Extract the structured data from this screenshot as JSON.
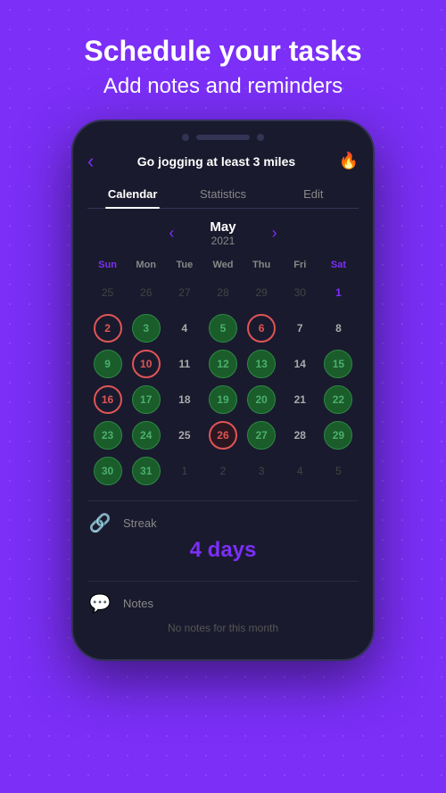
{
  "header": {
    "line1": "Schedule your tasks",
    "line2": "Add notes and reminders"
  },
  "phone": {
    "task_title": "Go jogging at least 3 miles",
    "tabs": [
      {
        "label": "Calendar",
        "active": true
      },
      {
        "label": "Statistics",
        "active": false
      },
      {
        "label": "Edit",
        "active": false
      }
    ],
    "calendar": {
      "month": "May",
      "year": "2021",
      "weekdays": [
        "Sun",
        "Mon",
        "Tue",
        "Wed",
        "Thu",
        "Fri",
        "Sat"
      ],
      "rows": [
        [
          {
            "num": "25",
            "type": "empty"
          },
          {
            "num": "26",
            "type": "empty"
          },
          {
            "num": "27",
            "type": "empty"
          },
          {
            "num": "28",
            "type": "empty"
          },
          {
            "num": "29",
            "type": "empty"
          },
          {
            "num": "30",
            "type": "empty"
          },
          {
            "num": "1",
            "type": "sat-num"
          }
        ],
        [
          {
            "num": "2",
            "type": "highlight-red"
          },
          {
            "num": "3",
            "type": "green"
          },
          {
            "num": "4",
            "type": "normal"
          },
          {
            "num": "5",
            "type": "green"
          },
          {
            "num": "6",
            "type": "highlight-red"
          },
          {
            "num": "7",
            "type": "normal"
          },
          {
            "num": "8",
            "type": "normal"
          }
        ],
        [
          {
            "num": "9",
            "type": "green"
          },
          {
            "num": "10",
            "type": "highlight-red"
          },
          {
            "num": "11",
            "type": "normal"
          },
          {
            "num": "12",
            "type": "green"
          },
          {
            "num": "13",
            "type": "green"
          },
          {
            "num": "14",
            "type": "normal"
          },
          {
            "num": "15",
            "type": "green"
          }
        ],
        [
          {
            "num": "16",
            "type": "highlight-red"
          },
          {
            "num": "17",
            "type": "green"
          },
          {
            "num": "18",
            "type": "normal"
          },
          {
            "num": "19",
            "type": "green"
          },
          {
            "num": "20",
            "type": "green"
          },
          {
            "num": "21",
            "type": "normal"
          },
          {
            "num": "22",
            "type": "green"
          }
        ],
        [
          {
            "num": "23",
            "type": "green"
          },
          {
            "num": "24",
            "type": "green"
          },
          {
            "num": "25",
            "type": "normal"
          },
          {
            "num": "26",
            "type": "today-red"
          },
          {
            "num": "27",
            "type": "green"
          },
          {
            "num": "28",
            "type": "normal"
          },
          {
            "num": "29",
            "type": "green"
          }
        ],
        [
          {
            "num": "30",
            "type": "green"
          },
          {
            "num": "31",
            "type": "green"
          },
          {
            "num": "1",
            "type": "empty"
          },
          {
            "num": "2",
            "type": "empty"
          },
          {
            "num": "3",
            "type": "empty"
          },
          {
            "num": "4",
            "type": "empty"
          },
          {
            "num": "5",
            "type": "empty"
          }
        ]
      ]
    },
    "streak": {
      "label": "Streak",
      "value": "4 days"
    },
    "notes": {
      "label": "Notes",
      "empty_message": "No notes for this month"
    }
  }
}
